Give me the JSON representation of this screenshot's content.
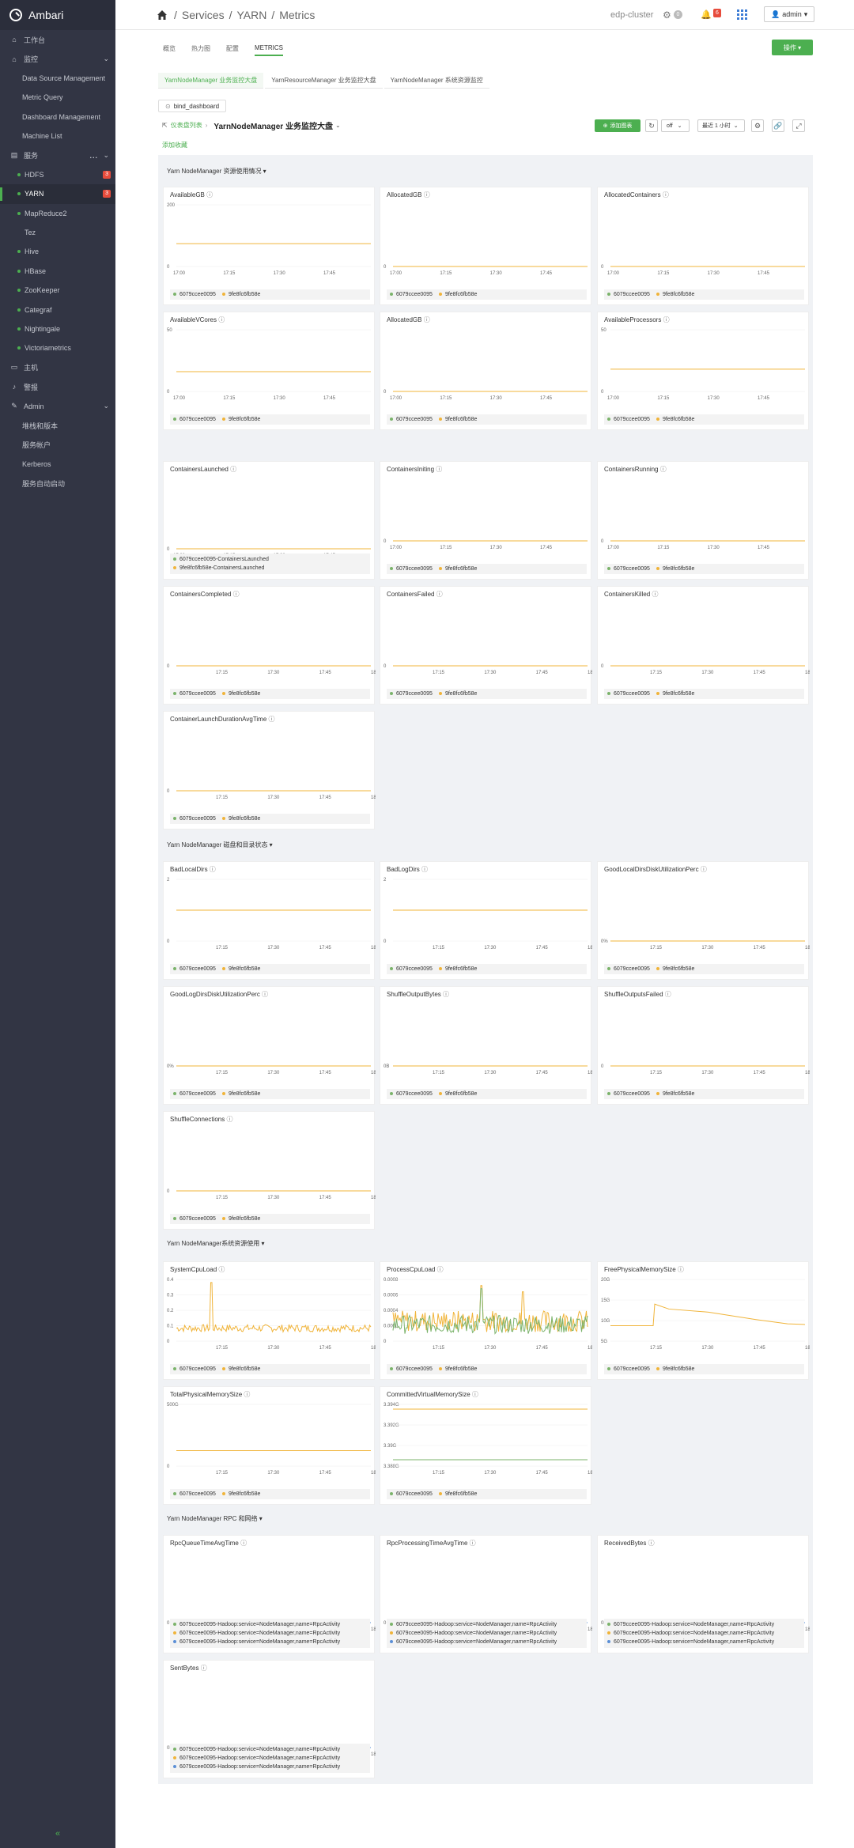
{
  "sidebar": {
    "app_name": "Ambari",
    "items": [
      {
        "label": "工作台",
        "icon": "home-icon",
        "kind": "top"
      },
      {
        "label": "监控",
        "icon": "home-icon",
        "kind": "top",
        "chev": "⌄"
      },
      {
        "label": "Data Source Management",
        "kind": "sub"
      },
      {
        "label": "Metric Query",
        "kind": "sub"
      },
      {
        "label": "Dashboard Management",
        "kind": "sub"
      },
      {
        "label": "Machine List",
        "kind": "sub"
      },
      {
        "label": "服务",
        "icon": "briefcase-icon",
        "kind": "top",
        "chev": "⌄",
        "dots": "..."
      },
      {
        "label": "HDFS",
        "kind": "svc",
        "badge": "3"
      },
      {
        "label": "YARN",
        "kind": "svc",
        "badge": "3",
        "active": true
      },
      {
        "label": "MapReduce2",
        "kind": "svc"
      },
      {
        "label": "Tez",
        "kind": "svc",
        "nodot": true
      },
      {
        "label": "Hive",
        "kind": "svc"
      },
      {
        "label": "HBase",
        "kind": "svc"
      },
      {
        "label": "ZooKeeper",
        "kind": "svc"
      },
      {
        "label": "Categraf",
        "kind": "svc"
      },
      {
        "label": "Nightingale",
        "kind": "svc"
      },
      {
        "label": "Victoriametrics",
        "kind": "svc"
      },
      {
        "label": "主机",
        "icon": "server-icon",
        "kind": "top"
      },
      {
        "label": "警报",
        "icon": "bell-icon",
        "kind": "top"
      },
      {
        "label": "Admin",
        "icon": "wrench-icon",
        "kind": "top",
        "chev": "⌄"
      },
      {
        "label": "堆栈和版本",
        "kind": "sub"
      },
      {
        "label": "服务帐户",
        "kind": "sub"
      },
      {
        "label": "Kerberos",
        "kind": "sub"
      },
      {
        "label": "服务自动启动",
        "kind": "sub"
      }
    ],
    "collapse_glyph": "«"
  },
  "header": {
    "breadcrumb": [
      "Services",
      "YARN",
      "Metrics"
    ],
    "separator": "/",
    "cluster": "edp-cluster",
    "settings_badge": "0",
    "alerts_badge": "6",
    "user": "admin"
  },
  "tabs": [
    {
      "label": "概览",
      "active": false
    },
    {
      "label": "热力图",
      "active": false
    },
    {
      "label": "配置",
      "active": false
    },
    {
      "label": "METRICS",
      "active": true
    }
  ],
  "operations_button": "操作 ▾",
  "subtabs": [
    {
      "label": "YarnNodeManager 业务监控大盘",
      "active": true
    },
    {
      "label": "YarnResourceManager 业务监控大盘",
      "active": false
    },
    {
      "label": "YarnNodeManager 系统资源监控",
      "active": false
    }
  ],
  "dashboard": {
    "selector": "bind_dashboard",
    "back_link": "仪表盘列表",
    "title": "YarnNodeManager 业务监控大盘",
    "add_favorite": "添加收藏",
    "add_chart": "添加图表",
    "refresh": "off",
    "time_range": "最近 1 小时"
  },
  "legend_hosts": [
    "6079ccee0095",
    "9fe8fc6fb58e"
  ],
  "colors": {
    "host_a": "#7bb36b",
    "host_b": "#f0b43a",
    "host_c": "#5b8fd6",
    "accent": "#4caf50"
  },
  "sections": [
    {
      "title": "Yarn NodeManager 资源使用情况"
    },
    {
      "title": "Yarn NodeManager 磁盘和目录状态"
    },
    {
      "title": "Yarn NodeManager系统资源使用"
    },
    {
      "title": "Yarn NodeManager RPC 和网络"
    }
  ],
  "panels": [
    {
      "title": "AvailableGB",
      "y_labels": [
        "200",
        "0"
      ],
      "x_labels": [
        "17:00",
        "17:15",
        "17:30",
        "17:45"
      ]
    },
    {
      "title": "AllocatedGB",
      "y_labels": [
        "0"
      ],
      "x_labels": [
        "17:00",
        "17:15",
        "17:30",
        "17:45"
      ]
    },
    {
      "title": "AllocatedContainers",
      "y_labels": [
        "0"
      ],
      "x_labels": [
        "17:00",
        "17:15",
        "17:30",
        "17:45"
      ]
    },
    {
      "title": "AvailableVCores",
      "y_labels": [
        "50",
        "0"
      ],
      "x_labels": [
        "17:00",
        "17:15",
        "17:30",
        "17:45"
      ]
    },
    {
      "title": "AllocatedGB",
      "y_labels": [
        "0"
      ],
      "x_labels": [
        "17:00",
        "17:15",
        "17:30",
        "17:45"
      ]
    },
    {
      "title": "AvailableProcessors",
      "y_labels": [
        "50",
        "0"
      ],
      "x_labels": [
        "17:00",
        "17:15",
        "17:30",
        "17:45"
      ]
    },
    {
      "title": "ContainersLaunched",
      "y_labels": [
        "0"
      ],
      "x_labels": [
        "17:00",
        "17:15",
        "17:30",
        "17:45"
      ],
      "legend": [
        "6079ccee0095-ContainersLaunched",
        "9fe8fc6fb58e-ContainersLaunched"
      ]
    },
    {
      "title": "ContainersIniting",
      "y_labels": [
        "0"
      ],
      "x_labels": [
        "17:00",
        "17:15",
        "17:30",
        "17:45"
      ]
    },
    {
      "title": "ContainersRunning",
      "y_labels": [
        "0"
      ],
      "x_labels": [
        "17:00",
        "17:15",
        "17:30",
        "17:45"
      ]
    },
    {
      "title": "ContainersCompleted",
      "y_labels": [
        "0"
      ],
      "x_labels": [
        "17:15",
        "17:30",
        "17:45",
        "18"
      ]
    },
    {
      "title": "ContainersFailed",
      "y_labels": [
        "0"
      ],
      "x_labels": [
        "17:15",
        "17:30",
        "17:45",
        "18"
      ]
    },
    {
      "title": "ContainersKilled",
      "y_labels": [
        "0"
      ],
      "x_labels": [
        "17:15",
        "17:30",
        "17:45",
        "18"
      ]
    },
    {
      "title": "ContainerLaunchDurationAvgTime",
      "y_labels": [
        "0"
      ],
      "x_labels": [
        "17:15",
        "17:30",
        "17:45",
        "18"
      ]
    },
    {
      "title": "BadLocalDirs",
      "y_labels": [
        "2",
        "0"
      ],
      "x_labels": [
        "17:15",
        "17:30",
        "17:45",
        "18"
      ]
    },
    {
      "title": "BadLogDirs",
      "y_labels": [
        "2",
        "0"
      ],
      "x_labels": [
        "17:15",
        "17:30",
        "17:45",
        "18"
      ]
    },
    {
      "title": "GoodLocalDirsDiskUtilizationPerc",
      "y_labels": [
        "0%"
      ],
      "x_labels": [
        "17:15",
        "17:30",
        "17:45",
        "18"
      ]
    },
    {
      "title": "GoodLogDirsDiskUtilizationPerc",
      "y_labels": [
        "0%"
      ],
      "x_labels": [
        "17:15",
        "17:30",
        "17:45",
        "18"
      ]
    },
    {
      "title": "ShuffleOutputBytes",
      "y_labels": [
        "0B"
      ],
      "x_labels": [
        "17:15",
        "17:30",
        "17:45",
        "18"
      ]
    },
    {
      "title": "ShuffleOutputsFailed",
      "y_labels": [
        "0"
      ],
      "x_labels": [
        "17:15",
        "17:30",
        "17:45",
        "18"
      ]
    },
    {
      "title": "ShuffleConnections",
      "y_labels": [
        "0"
      ],
      "x_labels": [
        "17:15",
        "17:30",
        "17:45",
        "18"
      ]
    },
    {
      "title": "SystemCpuLoad",
      "y_labels": [
        "0.4",
        "0.3",
        "0.2",
        "0.1",
        "0"
      ],
      "x_labels": [
        "17:15",
        "17:30",
        "17:45",
        "18"
      ]
    },
    {
      "title": "ProcessCpuLoad",
      "y_labels": [
        "0.0008",
        "0.0006",
        "0.0004",
        "0.0002",
        "0"
      ],
      "x_labels": [
        "17:15",
        "17:30",
        "17:45",
        "18"
      ]
    },
    {
      "title": "FreePhysicalMemorySize",
      "y_labels": [
        "20G",
        "15G",
        "10G",
        "5G"
      ],
      "x_labels": [
        "17:15",
        "17:30",
        "17:45",
        "18"
      ]
    },
    {
      "title": "TotalPhysicalMemorySize",
      "y_labels": [
        "500G",
        "0"
      ],
      "x_labels": [
        "17:15",
        "17:30",
        "17:45",
        "18"
      ]
    },
    {
      "title": "CommittedVirtualMemorySize",
      "y_labels": [
        "3.394G",
        "3.392G",
        "3.39G",
        "3.388G"
      ],
      "x_labels": [
        "17:15",
        "17:30",
        "17:45",
        "18"
      ]
    },
    {
      "title": "RpcQueueTimeAvgTime",
      "y_labels": [
        "0"
      ],
      "x_labels": [
        "17:15",
        "17:30",
        "17:45",
        "18"
      ],
      "legend": [
        "6079ccee0095-Hadoop:service=NodeManager,name=RpcActivity",
        "6079ccee0095-Hadoop:service=NodeManager,name=RpcActivity",
        "6079ccee0095-Hadoop:service=NodeManager,name=RpcActivity"
      ]
    },
    {
      "title": "RpcProcessingTimeAvgTime",
      "y_labels": [
        "0"
      ],
      "x_labels": [
        "17:15",
        "17:30",
        "17:45",
        "18"
      ],
      "legend": [
        "6079ccee0095-Hadoop:service=NodeManager,name=RpcActivity",
        "6079ccee0095-Hadoop:service=NodeManager,name=RpcActivity",
        "6079ccee0095-Hadoop:service=NodeManager,name=RpcActivity"
      ]
    },
    {
      "title": "ReceivedBytes",
      "y_labels": [
        "0B"
      ],
      "x_labels": [
        "17:15",
        "17:30",
        "17:45",
        "18"
      ],
      "legend": [
        "6079ccee0095-Hadoop:service=NodeManager,name=RpcActivity",
        "6079ccee0095-Hadoop:service=NodeManager,name=RpcActivity",
        "6079ccee0095-Hadoop:service=NodeManager,name=RpcActivity"
      ]
    },
    {
      "title": "SentBytes",
      "y_labels": [
        "0B"
      ],
      "x_labels": [
        "17:15",
        "17:30",
        "17:45",
        "18"
      ],
      "legend": [
        "6079ccee0095-Hadoop:service=NodeManager,name=RpcActivity",
        "6079ccee0095-Hadoop:service=NodeManager,name=RpcActivity",
        "6079ccee0095-Hadoop:service=NodeManager,name=RpcActivity"
      ]
    }
  ]
}
